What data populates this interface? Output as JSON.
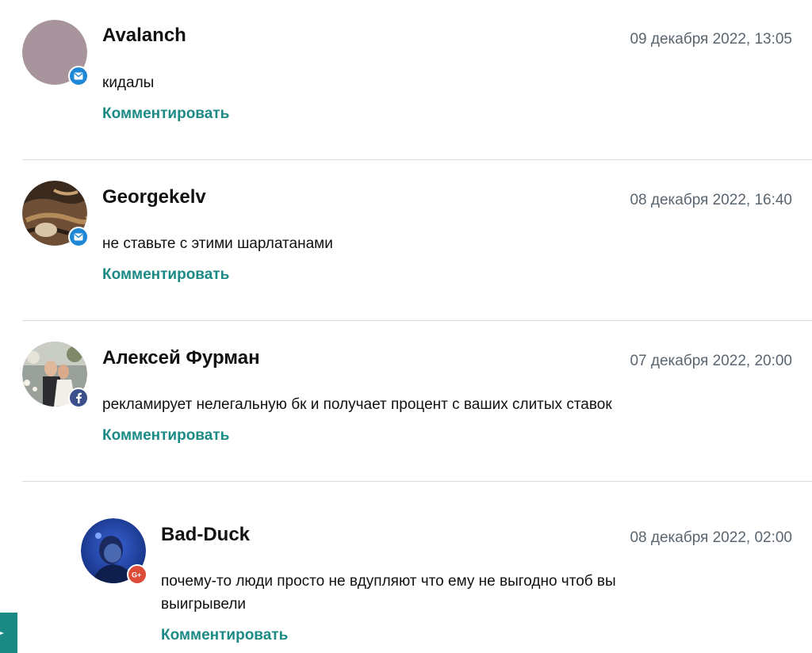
{
  "comments": [
    {
      "author": "Avalanch",
      "date": "09 декабря 2022, 13:05",
      "text": "кидалы",
      "reply_label": "Комментировать",
      "source_icon": "mail-icon",
      "avatar_color": "#a8949c"
    },
    {
      "author": "Georgekelv",
      "date": "08 декабря 2022, 16:40",
      "text": "не ставьте с этими шарлатанами",
      "reply_label": "Комментировать",
      "source_icon": "mail-icon",
      "avatar_color": "#7a5a40"
    },
    {
      "author": "Алексей Фурман",
      "date": "07 декабря 2022, 20:00",
      "text": "рекламирует нелегальную бк и получает процент с ваших слитых ставок",
      "reply_label": "Комментировать",
      "source_icon": "facebook-icon",
      "avatar_color": "#8a8f86"
    },
    {
      "author": "Bad-Duck",
      "date": "08 декабря 2022, 02:00",
      "text": "почему-то люди просто не вдупляют что ему не выгодно чтоб вы выигрывели",
      "reply_label": "Комментировать",
      "source_icon": "google-plus-icon",
      "avatar_color": "#1d3f9e"
    }
  ],
  "colors": {
    "accent": "#1b8a85",
    "date_text": "#5a6570",
    "divider": "#dcdcdc",
    "mail_badge": "#1e88d6",
    "facebook_badge": "#3b4f8a",
    "google_plus_badge": "#dd4b39"
  }
}
